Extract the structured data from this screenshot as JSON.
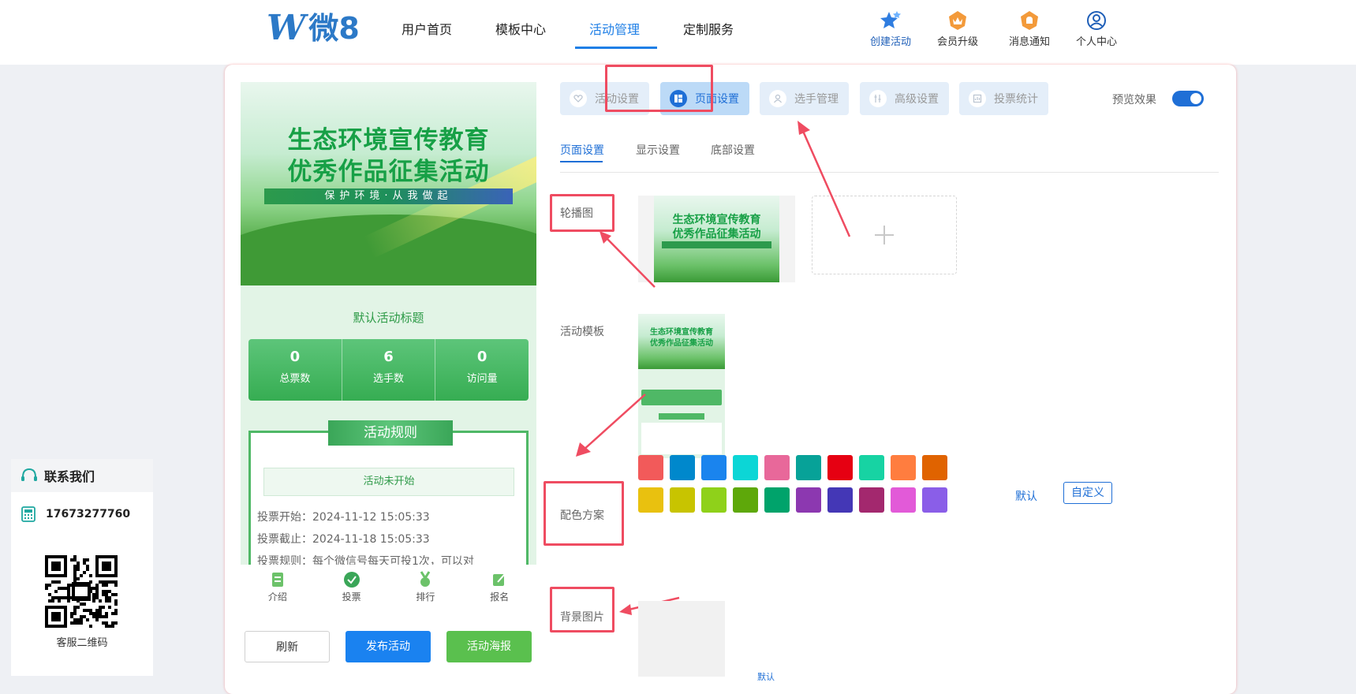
{
  "brand": {
    "logo_mark": "W",
    "logo_text": "微8",
    "color": "#2c79c7"
  },
  "nav": [
    {
      "label": "用户首页",
      "active": false
    },
    {
      "label": "模板中心",
      "active": false
    },
    {
      "label": "活动管理",
      "active": true
    },
    {
      "label": "定制服务",
      "active": false
    }
  ],
  "tools": [
    {
      "label": "创建活动",
      "icon": "star-icon"
    },
    {
      "label": "会员升级",
      "icon": "crown-badge-icon"
    },
    {
      "label": "消息通知",
      "icon": "bell-badge-icon"
    },
    {
      "label": "个人中心",
      "icon": "user-icon"
    }
  ],
  "preview": {
    "banner_title_1": "生态环境宣传教育",
    "banner_title_2": "优秀作品征集活动",
    "banner_slogan": "保护环境·从我做起",
    "activity_title": "默认活动标题",
    "stats": [
      {
        "value": "0",
        "label": "总票数"
      },
      {
        "value": "6",
        "label": "选手数"
      },
      {
        "value": "0",
        "label": "访问量"
      }
    ],
    "rules_heading": "活动规则",
    "status_text": "活动未开始",
    "vote_start": "投票开始：2024-11-12 15:05:33",
    "vote_end": "投票截止：2024-11-18 15:05:33",
    "vote_rule": "投票规则：每个微信号每天可投1次，可以对",
    "bottom_nav": [
      {
        "label": "介绍",
        "icon": "document-icon"
      },
      {
        "label": "投票",
        "icon": "vote-icon"
      },
      {
        "label": "排行",
        "icon": "medal-icon"
      },
      {
        "label": "报名",
        "icon": "edit-icon"
      }
    ]
  },
  "actions": {
    "refresh": "刷新",
    "publish": "发布活动",
    "poster": "活动海报"
  },
  "tabs": [
    {
      "label": "活动设置",
      "icon": "heart-icon",
      "active": false
    },
    {
      "label": "页面设置",
      "icon": "layout-icon",
      "active": true
    },
    {
      "label": "选手管理",
      "icon": "person-icon",
      "active": false
    },
    {
      "label": "高级设置",
      "icon": "tools-icon",
      "active": false
    },
    {
      "label": "投票统计",
      "icon": "chart-icon",
      "active": false
    }
  ],
  "preview_toggle": {
    "label": "预览效果",
    "on": true
  },
  "subtabs": [
    {
      "label": "页面设置",
      "active": true
    },
    {
      "label": "显示设置",
      "active": false
    },
    {
      "label": "底部设置",
      "active": false
    }
  ],
  "fields": {
    "carousel": "轮播图",
    "template": "活动模板",
    "color_scheme": "配色方案",
    "bg_image": "背景图片"
  },
  "color_swatches": [
    "#f25a5a",
    "#0088cc",
    "#1a84ee",
    "#0cd6d6",
    "#e8689a",
    "#07a298",
    "#e60012",
    "#17d3a3",
    "#ff7d3f",
    "#e06300",
    "#e9c10f",
    "#c8c400",
    "#8fd11a",
    "#5ea80a",
    "#00a36b",
    "#8c38b0",
    "#4437b6",
    "#a3286e",
    "#e25ad8",
    "#8a5ee8"
  ],
  "color_options": {
    "default": "默认",
    "custom": "自定义"
  },
  "bg_link": "默认",
  "contact": {
    "title": "联系我们",
    "phone": "17673277760",
    "qr_label": "客服二维码"
  }
}
